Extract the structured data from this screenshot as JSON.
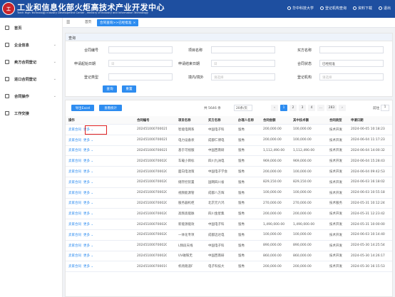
{
  "header": {
    "logo_text": "工",
    "title": "工业和信息化部火炬高技术产业开发中心",
    "subtitle": "Torch High Technology Industry Development Center , Ministry of Industry and Information Technology",
    "links": [
      "华中科技大学",
      "登记机构查询",
      "资料下载",
      "退出"
    ]
  },
  "sidebar": {
    "items": [
      {
        "label": "首页",
        "has_arrow": false
      },
      {
        "label": "企业信息",
        "has_arrow": true
      },
      {
        "label": "卖方合同登记",
        "has_arrow": true
      },
      {
        "label": "进口合同登记",
        "has_arrow": true
      },
      {
        "label": "合同操作",
        "has_arrow": true
      },
      {
        "label": "工作交接",
        "has_arrow": false
      }
    ]
  },
  "tabs": {
    "home": "首页",
    "active": "合同查询>>已经批准"
  },
  "query": {
    "panel_title": "查询",
    "fields": {
      "contract_no": {
        "label": "合同编号",
        "placeholder": ""
      },
      "project_name": {
        "label": "项目名称",
        "placeholder": ""
      },
      "buyer_name": {
        "label": "买方名称",
        "placeholder": ""
      },
      "apply_start": {
        "label": "申请起始日期",
        "placeholder": "日"
      },
      "apply_end": {
        "label": "申请结束日期",
        "placeholder": "日"
      },
      "contract_status": {
        "label": "合同状态",
        "value": "已经批准"
      },
      "reg_type": {
        "label": "登记类型",
        "placeholder": ""
      },
      "domestic": {
        "label": "境内/境外",
        "placeholder": "请选择"
      },
      "reg_org": {
        "label": "登记机构",
        "placeholder": "请选择"
      }
    },
    "search_btn": "查询",
    "reset_btn": "重置"
  },
  "table_panel": {
    "export_btn": "导出Excel",
    "stats_btn": "查看统计",
    "total_text": "共 5646 条",
    "page_size": "20条/页",
    "pages": [
      "1",
      "2",
      "3",
      "4",
      "...",
      "283"
    ],
    "current_page": "1",
    "goto_label": "前往",
    "goto_value": "1",
    "columns": [
      "操作",
      "合同编号",
      "项目名称",
      "买方名称",
      "办理人名称",
      "合同金额",
      "其中技术额",
      "合同类型",
      "申请日期"
    ],
    "action_link": "卖家合同",
    "more_link": "更多",
    "rows": [
      {
        "no": "20245100070002122",
        "project": "智能电网系",
        "buyer": "中国电子科",
        "handler": "留秀",
        "amount": "200,000.00",
        "tech": "100,000.00",
        "type": "技术开发",
        "date": "2024-06-05 10:18:23"
      },
      {
        "no": "20245100070002111",
        "project": "电力设备状",
        "buyer": "成都仁博电",
        "handler": "留秀",
        "amount": "200,000.00",
        "tech": "100,000.00",
        "type": "技术开发",
        "date": "2024-06-04 11:17:23"
      },
      {
        "no": "20245100070002103",
        "project": "基于可视服",
        "buyer": "中国西南研",
        "handler": "留秀",
        "amount": "1,112,490.00",
        "tech": "1,112,490.00",
        "type": "技术开发",
        "date": "2024-06-04 14:00:32"
      },
      {
        "no": "20245100070002059",
        "project": "车载小目标",
        "buyer": "四川九洲电",
        "handler": "留秀",
        "amount": "969,000.00",
        "tech": "969,000.00",
        "type": "技术开发",
        "date": "2024-06-04 15:28:43"
      },
      {
        "no": "20245100070002038",
        "project": "面向电池策",
        "buyer": "中国电子学会",
        "handler": "留秀",
        "amount": "200,000.00",
        "tech": "100,000.00",
        "type": "技术开发",
        "date": "2024-06-04 09:42:53"
      },
      {
        "no": "20245100070002007",
        "project": "储存控装置",
        "buyer": "国网四川省",
        "handler": "留秀",
        "amount": "829,150.00",
        "tech": "829,150.00",
        "type": "技术开发",
        "date": "2024-06-03 16:18:02"
      },
      {
        "no": "20245100070002006",
        "project": "视频能源管",
        "buyer": "成都八方辉",
        "handler": "留秀",
        "amount": "100,000.00",
        "tech": "100,000.00",
        "type": "技术开发",
        "date": "2024-06-03 10:55:18"
      },
      {
        "no": "20245100070002005",
        "project": "服务器机柜",
        "buyer": "北京元六鸿",
        "handler": "留秀",
        "amount": "270,000.00",
        "tech": "270,000.00",
        "type": "技术服务",
        "date": "2024-05-31 10:12:24"
      },
      {
        "no": "20245100070002004",
        "project": "高频高能脉",
        "buyer": "四川金星集",
        "handler": "留秀",
        "amount": "200,000.00",
        "tech": "200,000.00",
        "type": "技术开发",
        "date": "2024-05-31 12:23:42"
      },
      {
        "no": "20245100070002003",
        "project": "新能源能效",
        "buyer": "中国电子科",
        "handler": "留秀",
        "amount": "1,490,000.00",
        "tech": "1,490,000.00",
        "type": "技术开发",
        "date": "2024-05-31 10:00:00"
      },
      {
        "no": "20245100070002002",
        "project": "一体化专项",
        "buyer": "成都迈达电",
        "handler": "留秀",
        "amount": "100,000.00",
        "tech": "100,000.00",
        "type": "技术开发",
        "date": "2024-06-03 10:14:40"
      },
      {
        "no": "20245100070002001",
        "project": "L频段天线",
        "buyer": "中国电子科",
        "handler": "留秀",
        "amount": "890,000.00",
        "tech": "890,000.00",
        "type": "技术开发",
        "date": "2024-05-30 14:25:54"
      },
      {
        "no": "20245100070002000",
        "project": "UV磁铁无",
        "buyer": "中国西南研",
        "handler": "留秀",
        "amount": "860,000.00",
        "tech": "860,000.00",
        "type": "技术开发",
        "date": "2024-05-30 14:26:17"
      },
      {
        "no": "20245100070001990",
        "project": "机场跑道F",
        "buyer": "电子科技大",
        "handler": "留秀",
        "amount": "200,000.00",
        "tech": "200,000.00",
        "type": "技术开发",
        "date": "2024-05-30 16:15:53"
      }
    ]
  },
  "colors": {
    "header": "#1e4fa0",
    "accent": "#2d8cf0",
    "highlight": "#e02020"
  }
}
